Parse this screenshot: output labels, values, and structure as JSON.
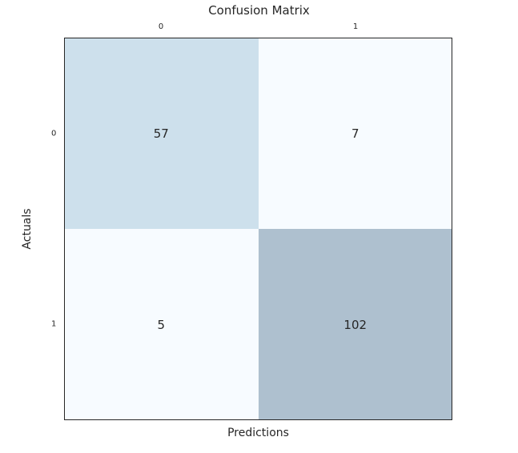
{
  "chart_data": {
    "type": "heatmap",
    "title": "Confusion Matrix",
    "xlabel": "Predictions",
    "ylabel": "Actuals",
    "x_categories": [
      "0",
      "1"
    ],
    "y_categories": [
      "0",
      "1"
    ],
    "matrix": [
      [
        57,
        7
      ],
      [
        5,
        102
      ]
    ],
    "cell_colors": [
      [
        "#cde0ec",
        "#f7fbff"
      ],
      [
        "#f7fbff",
        "#aec0cf"
      ]
    ]
  }
}
